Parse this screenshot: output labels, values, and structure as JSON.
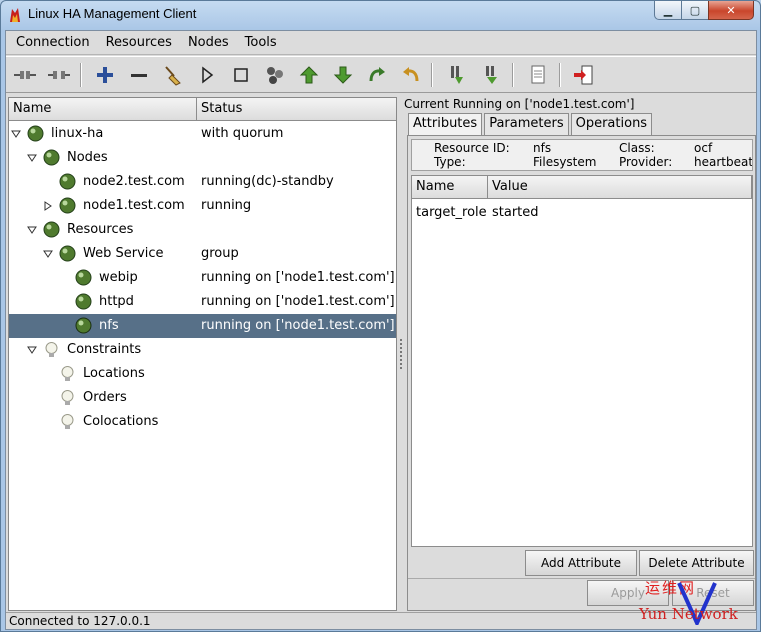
{
  "window": {
    "title": "Linux HA Management Client"
  },
  "menu": [
    "Connection",
    "Resources",
    "Nodes",
    "Tools"
  ],
  "toolbar": {
    "icons": [
      "connect-icon",
      "disconnect-icon",
      "add-icon",
      "remove-icon",
      "cleanup-icon",
      "start-icon",
      "stop-icon",
      "workflow-icon",
      "up-icon",
      "down-icon",
      "redo-icon",
      "undo-icon",
      "standby-icon",
      "active-icon",
      "log-icon",
      "exit-icon"
    ]
  },
  "tree": {
    "headers": {
      "name": "Name",
      "status": "Status"
    },
    "rows": [
      {
        "label": "linux-ha",
        "status": "with quorum"
      },
      {
        "label": "Nodes",
        "status": ""
      },
      {
        "label": "node2.test.com",
        "status": "running(dc)-standby"
      },
      {
        "label": "node1.test.com",
        "status": "running"
      },
      {
        "label": "Resources",
        "status": ""
      },
      {
        "label": "Web Service",
        "status": "group"
      },
      {
        "label": "webip",
        "status": "running on ['node1.test.com']"
      },
      {
        "label": "httpd",
        "status": "running on ['node1.test.com']"
      },
      {
        "label": "nfs",
        "status": "running on ['node1.test.com']"
      },
      {
        "label": "Constraints",
        "status": ""
      },
      {
        "label": "Locations",
        "status": ""
      },
      {
        "label": "Orders",
        "status": ""
      },
      {
        "label": "Colocations",
        "status": ""
      }
    ]
  },
  "detail": {
    "title": "Current Running on ['node1.test.com']",
    "tabs": [
      "Attributes",
      "Parameters",
      "Operations"
    ],
    "info": {
      "resource_id_label": "Resource ID:",
      "resource_id": "nfs",
      "type_label": "Type:",
      "type": "Filesystem",
      "class_label": "Class:",
      "class": "ocf",
      "provider_label": "Provider:",
      "provider": "heartbeat"
    },
    "table": {
      "headers": {
        "name": "Name",
        "value": "Value"
      },
      "rows": [
        {
          "name": "target_role",
          "value": "started"
        }
      ]
    },
    "buttons": {
      "add": "Add Attribute",
      "delete": "Delete Attribute",
      "apply": "Apply",
      "reset": "Reset"
    }
  },
  "status_bar": "Connected to 127.0.0.1",
  "watermark": {
    "top": "运维网",
    "bottom": "Yun  Network",
    "letter": "V"
  }
}
